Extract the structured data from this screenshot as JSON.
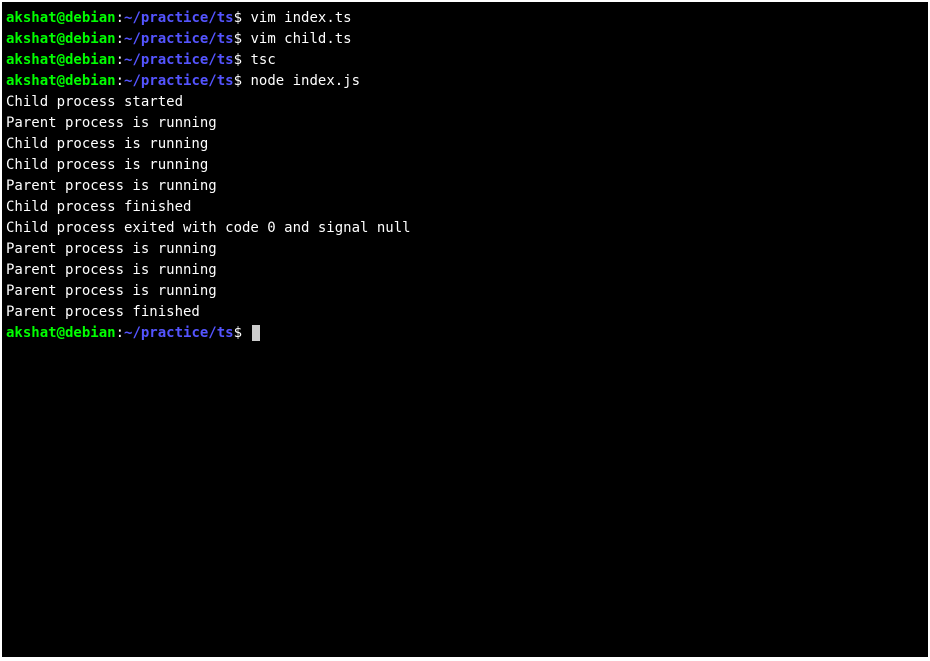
{
  "prompt": {
    "user": "akshat",
    "at": "@",
    "host": "debian",
    "colon": ":",
    "path": "~/practice/ts",
    "dollar": "$"
  },
  "lines": [
    {
      "type": "cmd",
      "command": " vim index.ts"
    },
    {
      "type": "cmd",
      "command": " vim child.ts"
    },
    {
      "type": "cmd",
      "command": " tsc"
    },
    {
      "type": "cmd",
      "command": " node index.js"
    },
    {
      "type": "out",
      "text": "Child process started"
    },
    {
      "type": "out",
      "text": "Parent process is running"
    },
    {
      "type": "out",
      "text": "Child process is running"
    },
    {
      "type": "out",
      "text": "Child process is running"
    },
    {
      "type": "out",
      "text": "Parent process is running"
    },
    {
      "type": "out",
      "text": "Child process finished"
    },
    {
      "type": "out",
      "text": "Child process exited with code 0 and signal null"
    },
    {
      "type": "out",
      "text": "Parent process is running"
    },
    {
      "type": "out",
      "text": "Parent process is running"
    },
    {
      "type": "out",
      "text": "Parent process is running"
    },
    {
      "type": "out",
      "text": "Parent process finished"
    },
    {
      "type": "cmd-cursor",
      "command": " "
    }
  ]
}
